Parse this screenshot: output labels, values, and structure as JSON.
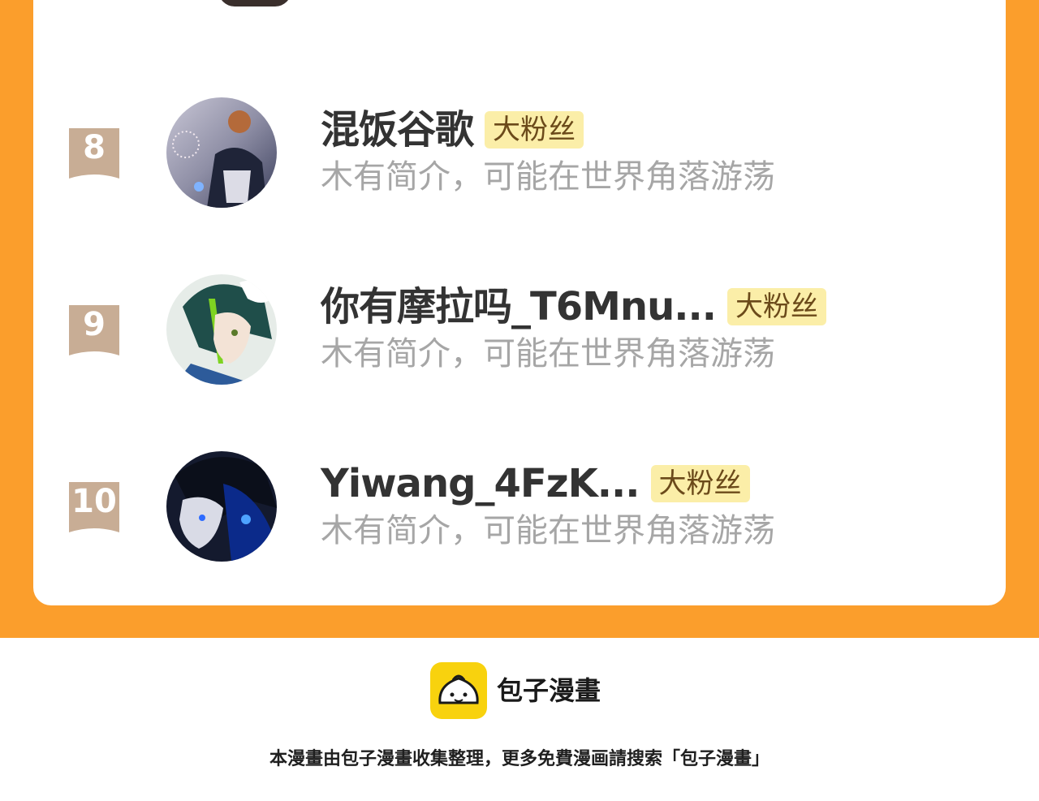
{
  "ranking": {
    "items": [
      {
        "rank": "8",
        "name": "混饭谷歌",
        "badge": "大粉丝",
        "bio": "木有简介，可能在世界角落游荡",
        "avatar": "avatar-8"
      },
      {
        "rank": "9",
        "name": "你有摩拉吗_T6Mnu...",
        "badge": "大粉丝",
        "bio": "木有简介，可能在世界角落游荡",
        "avatar": "avatar-9"
      },
      {
        "rank": "10",
        "name": "Yiwang_4FzK...",
        "badge": "大粉丝",
        "bio": "木有简介，可能在世界角落游荡",
        "avatar": "avatar-10"
      }
    ]
  },
  "footer": {
    "brand": "包子漫畫",
    "note": "本漫畫由包子漫畫收集整理，更多免費漫画請搜索「包子漫畫」",
    "logo_icon": "bun-logo-icon"
  },
  "colors": {
    "frame": "#fb9e2c",
    "badge_bg": "#fbeea8",
    "rank_flag": "#c8ad95",
    "logo_bg": "#f8d20e"
  }
}
